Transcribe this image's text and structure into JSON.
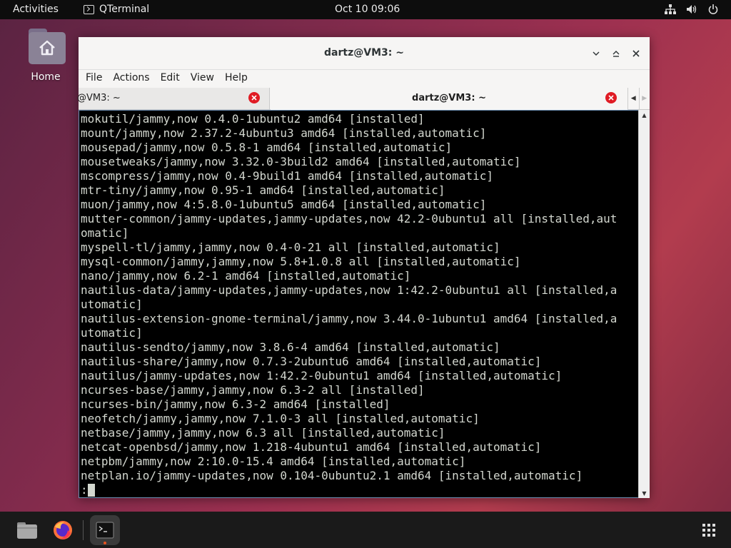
{
  "topbar": {
    "activities": "Activities",
    "app_name": "QTerminal",
    "clock": "Oct 10  09:06"
  },
  "desktop": {
    "home_label": "Home"
  },
  "window": {
    "title": "dartz@VM3: ~",
    "menu": [
      "File",
      "Actions",
      "Edit",
      "View",
      "Help"
    ],
    "tabs": [
      {
        "label": "@VM3: ~",
        "active": false
      },
      {
        "label": "dartz@VM3: ~",
        "active": true
      }
    ]
  },
  "terminal": {
    "lines": [
      "mokutil/jammy,now 0.4.0-1ubuntu2 amd64 [installed]",
      "mount/jammy,now 2.37.2-4ubuntu3 amd64 [installed,automatic]",
      "mousepad/jammy,now 0.5.8-1 amd64 [installed,automatic]",
      "mousetweaks/jammy,now 3.32.0-3build2 amd64 [installed,automatic]",
      "mscompress/jammy,now 0.4-9build1 amd64 [installed,automatic]",
      "mtr-tiny/jammy,now 0.95-1 amd64 [installed,automatic]",
      "muon/jammy,now 4:5.8.0-1ubuntu5 amd64 [installed,automatic]",
      "mutter-common/jammy-updates,jammy-updates,now 42.2-0ubuntu1 all [installed,aut",
      "omatic]",
      "myspell-tl/jammy,jammy,now 0.4-0-21 all [installed,automatic]",
      "mysql-common/jammy,jammy,now 5.8+1.0.8 all [installed,automatic]",
      "nano/jammy,now 6.2-1 amd64 [installed,automatic]",
      "nautilus-data/jammy-updates,jammy-updates,now 1:42.2-0ubuntu1 all [installed,a",
      "utomatic]",
      "nautilus-extension-gnome-terminal/jammy,now 3.44.0-1ubuntu1 amd64 [installed,a",
      "utomatic]",
      "nautilus-sendto/jammy,now 3.8.6-4 amd64 [installed,automatic]",
      "nautilus-share/jammy,now 0.7.3-2ubuntu6 amd64 [installed,automatic]",
      "nautilus/jammy-updates,now 1:42.2-0ubuntu1 amd64 [installed,automatic]",
      "ncurses-base/jammy,jammy,now 6.3-2 all [installed]",
      "ncurses-bin/jammy,now 6.3-2 amd64 [installed]",
      "neofetch/jammy,jammy,now 7.1.0-3 all [installed,automatic]",
      "netbase/jammy,jammy,now 6.3 all [installed,automatic]",
      "netcat-openbsd/jammy,now 1.218-4ubuntu1 amd64 [installed,automatic]",
      "netpbm/jammy,now 2:10.0-15.4 amd64 [installed,automatic]",
      "netplan.io/jammy-updates,now 0.104-0ubuntu2.1 amd64 [installed,automatic]"
    ],
    "prompt": ":"
  },
  "dock": {
    "items": [
      "files-icon",
      "firefox-icon",
      "qterminal-icon",
      "show-apps-icon"
    ]
  },
  "colors": {
    "topbar_bg": "#0d0d0d",
    "dock_bg": "#1a1a1a",
    "terminal_bg": "#000000",
    "terminal_fg": "#d3d7cf",
    "tab_close": "#e01b24",
    "accent": "#e95420"
  }
}
